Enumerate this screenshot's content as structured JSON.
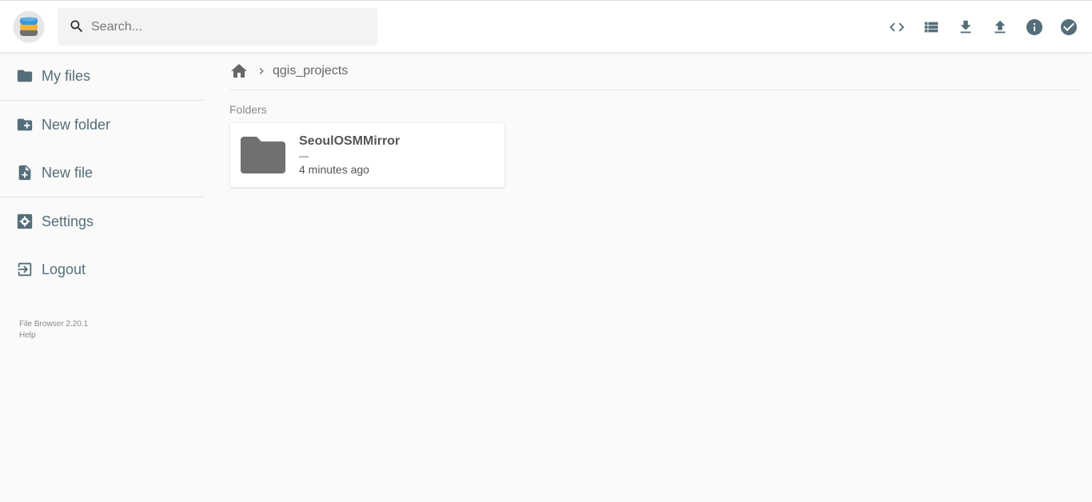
{
  "header": {
    "search": {
      "placeholder": "Search...",
      "value": ""
    },
    "actions": [
      {
        "name": "code-icon",
        "label": "Toggle shell"
      },
      {
        "name": "view-list-icon",
        "label": "Switch view"
      },
      {
        "name": "download-icon",
        "label": "Download"
      },
      {
        "name": "upload-icon",
        "label": "Upload"
      },
      {
        "name": "info-icon",
        "label": "Info"
      },
      {
        "name": "check-circle-icon",
        "label": "Select multiple"
      }
    ]
  },
  "sidebar": {
    "items": [
      {
        "label": "My files",
        "icon": "folder-icon"
      },
      {
        "label": "New folder",
        "icon": "create-new-folder-icon"
      },
      {
        "label": "New file",
        "icon": "note-add-icon"
      },
      {
        "label": "Settings",
        "icon": "settings-icon"
      },
      {
        "label": "Logout",
        "icon": "exit-icon"
      }
    ],
    "credits": {
      "version": "File Browser 2.20.1",
      "help": "Help"
    }
  },
  "main": {
    "breadcrumbs": [
      {
        "label": "qgis_projects"
      }
    ],
    "sections": [
      {
        "title": "Folders",
        "items": [
          {
            "name": "SeoulOSMMirror",
            "size": "—",
            "modified": "4 minutes ago"
          }
        ]
      }
    ]
  },
  "colors": {
    "icon": "#546e7a",
    "folder": "#707070",
    "background": "#fafafa"
  }
}
